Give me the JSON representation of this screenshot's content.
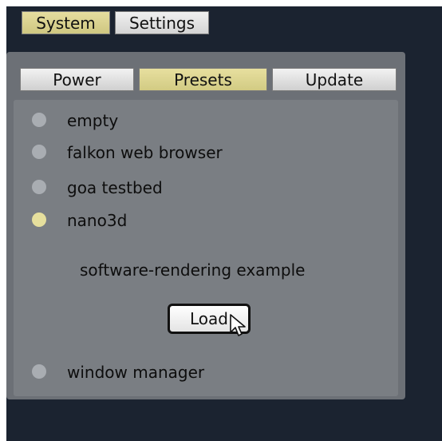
{
  "top_tabs": [
    {
      "label": "System",
      "active": true
    },
    {
      "label": "Settings",
      "active": false
    }
  ],
  "sub_tabs": [
    {
      "label": "Power",
      "active": false
    },
    {
      "label": "Presets",
      "active": true
    },
    {
      "label": "Update",
      "active": false
    }
  ],
  "presets": [
    {
      "label": "empty",
      "selected": false
    },
    {
      "label": "falkon web browser",
      "selected": false
    },
    {
      "label": "goa testbed",
      "selected": false
    },
    {
      "label": "nano3d",
      "selected": true
    },
    {
      "label": "window manager",
      "selected": false
    }
  ],
  "selected_preset": {
    "description": "software-rendering example",
    "load_label": "Load"
  },
  "colors": {
    "active_tab": "#d9d28e",
    "selected_radio": "#e6df9d",
    "background": "#1b2330"
  },
  "icons": {
    "cursor": "arrow-pointer-icon"
  }
}
